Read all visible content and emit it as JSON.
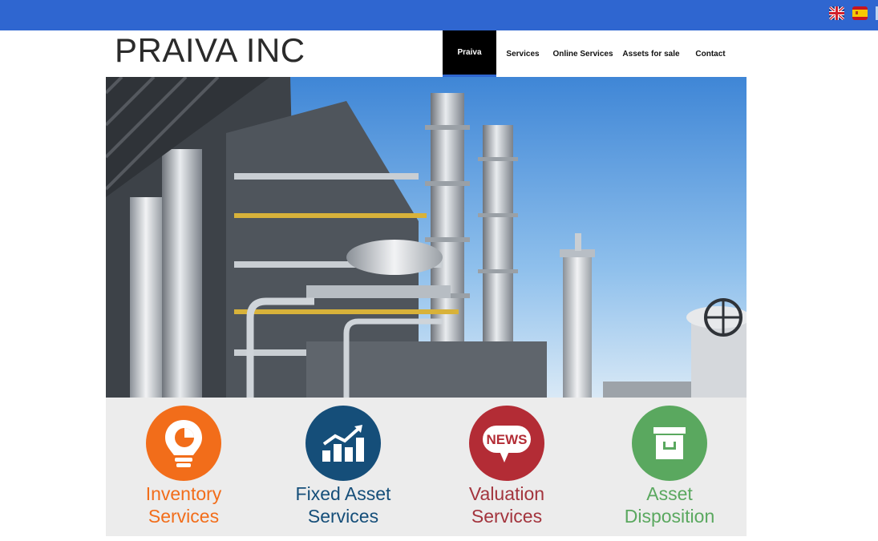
{
  "header": {
    "logo": "PRAIVA INC"
  },
  "language_flags": [
    {
      "icon": "uk-flag-icon"
    },
    {
      "icon": "spain-flag-icon"
    }
  ],
  "nav": {
    "items": [
      {
        "label": "Praiva",
        "active": true
      },
      {
        "label": "Services",
        "active": false
      },
      {
        "label": "Online Services",
        "active": false
      },
      {
        "label": "Assets for sale",
        "active": false
      },
      {
        "label": "Contact",
        "active": false
      }
    ]
  },
  "hero": {
    "icon": "refinery-photo"
  },
  "services": [
    {
      "line1": "Inventory",
      "line2": "Services",
      "color": "#f26d1a",
      "text_color": "#f26d1a",
      "icon": "lightbulb-chart-icon"
    },
    {
      "line1": "Fixed Asset",
      "line2": "Services",
      "color": "#154e79",
      "text_color": "#154e79",
      "icon": "growth-chart-icon"
    },
    {
      "line1": "Valuation",
      "line2": "Services",
      "color": "#b32c35",
      "text_color": "#a3343d",
      "icon": "news-bubble-icon",
      "icon_text": "NEWS"
    },
    {
      "line1": "Asset",
      "line2": "Disposition",
      "color": "#5aa85f",
      "text_color": "#5aa85f",
      "icon": "archive-box-icon"
    }
  ],
  "colors": {
    "topbar": "#2f66d0",
    "services_bg": "#ececec"
  }
}
